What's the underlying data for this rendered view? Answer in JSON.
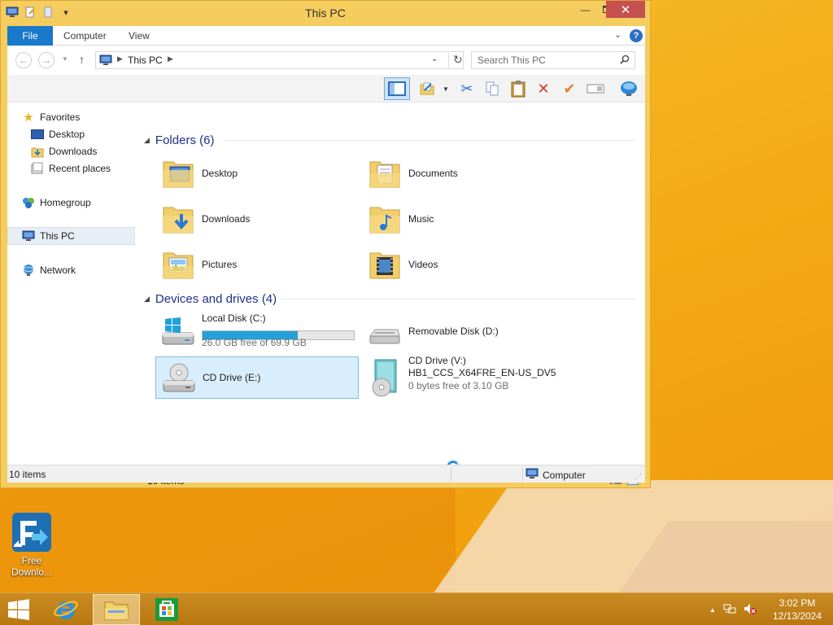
{
  "window": {
    "title": "This PC",
    "close_glyph": "✕",
    "minimize_glyph": "—",
    "maximize_glyph": "☐"
  },
  "ribbon": {
    "tabs": [
      "File",
      "Computer",
      "View"
    ],
    "help_glyph": "?",
    "expand_glyph": "⌄"
  },
  "address": {
    "location": "This PC",
    "search_placeholder": "Search This PC"
  },
  "navigation": {
    "favorites": "Favorites",
    "desktop": "Desktop",
    "downloads": "Downloads",
    "recent_places": "Recent places",
    "homegroup": "Homegroup",
    "this_pc": "This PC",
    "network": "Network"
  },
  "groups": {
    "folders": "Folders (6)",
    "devices": "Devices and drives (4)"
  },
  "folders": [
    {
      "name": "Desktop",
      "icon": "folder-desktop-icon"
    },
    {
      "name": "Documents",
      "icon": "folder-documents-icon"
    },
    {
      "name": "Downloads",
      "icon": "folder-downloads-icon"
    },
    {
      "name": "Music",
      "icon": "folder-music-icon"
    },
    {
      "name": "Pictures",
      "icon": "folder-pictures-icon"
    },
    {
      "name": "Videos",
      "icon": "folder-videos-icon"
    }
  ],
  "drives": {
    "c": {
      "name": "Local Disk (C:)",
      "free_text": "26.0 GB free of 69.9 GB",
      "used_fraction": 0.628
    },
    "d": {
      "name": "Removable Disk (D:)"
    },
    "e": {
      "name": "CD Drive (E:)"
    },
    "v": {
      "name": "CD Drive (V:)",
      "label": "HB1_CCS_X64FRE_EN-US_DV5",
      "free_text": "0 bytes free of 3.10 GB"
    }
  },
  "status": {
    "content_count": "10 items",
    "bar_count": "10 items",
    "computer": "Computer"
  },
  "desktop_icon": {
    "line1": "Free",
    "line2": "Downlo..."
  },
  "clock": {
    "time": "3:02 PM",
    "date": "12/13/2024"
  },
  "colors": {
    "accent": "#1979ca",
    "selection": "#d9eefc",
    "progress": "#26a0da",
    "desktop": "#f3aa13"
  }
}
